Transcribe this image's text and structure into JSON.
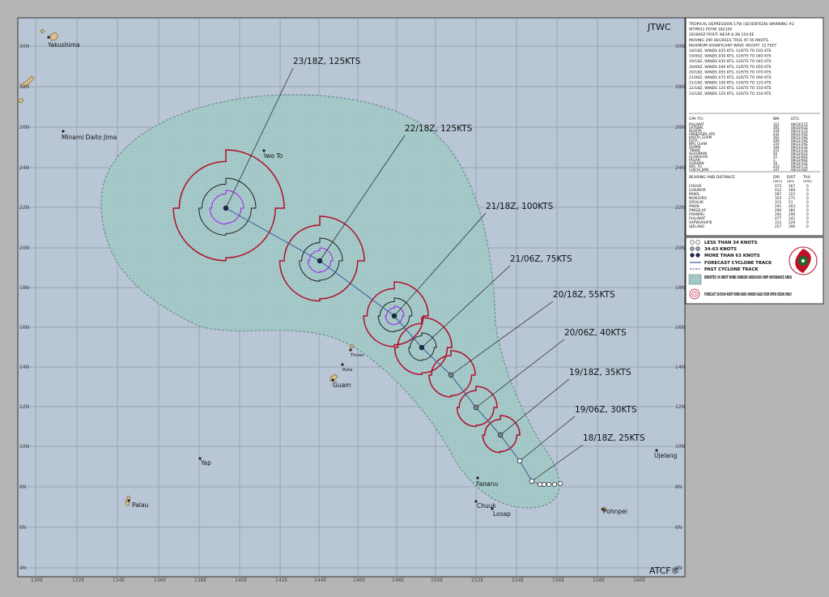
{
  "header": {
    "agency": "JTWC",
    "footer": "ATCF®"
  },
  "lat_labels": [
    "30N",
    "28N",
    "26N",
    "24N",
    "22N",
    "20N",
    "18N",
    "16N",
    "14N",
    "12N",
    "10N",
    "8N",
    "6N",
    "4N"
  ],
  "lon_labels": [
    "130E",
    "132E",
    "134E",
    "136E",
    "138E",
    "140E",
    "142E",
    "144E",
    "146E",
    "148E",
    "150E",
    "152E",
    "154E",
    "156E",
    "158E",
    "160E"
  ],
  "places": [
    {
      "name": "Yakushima"
    },
    {
      "name": "Minami Daito Jima"
    },
    {
      "name": "Iwo To"
    },
    {
      "name": "Tinian"
    },
    {
      "name": "Rota"
    },
    {
      "name": "Guam"
    },
    {
      "name": "Yap"
    },
    {
      "name": "Palau"
    },
    {
      "name": "Fananu"
    },
    {
      "name": "Chuuk"
    },
    {
      "name": "Losap"
    },
    {
      "name": "Pohnpei"
    },
    {
      "name": "Ujelang"
    }
  ],
  "forecast_points": [
    {
      "label": "18/18Z, 25KTS"
    },
    {
      "label": "19/06Z, 30KTS"
    },
    {
      "label": "19/18Z, 35KTS"
    },
    {
      "label": "20/06Z, 40KTS"
    },
    {
      "label": "20/18Z, 55KTS"
    },
    {
      "label": "21/06Z, 75KTS"
    },
    {
      "label": "21/18Z, 100KTS"
    },
    {
      "label": "22/18Z, 125KTS"
    },
    {
      "label": "23/18Z, 125KTS"
    }
  ],
  "warning_lines": [
    "TROPICAL DEPRESSION 17W (SEVENTEEN) WARNING #2",
    "WTPN31 PGTW 182100",
    "181800Z POSIT: NEAR 8.3N 154.6E",
    "MOVING 290 DEGREES TRUE AT 05 KNOTS",
    "MAXIMUM SIGNIFICANT WAVE HEIGHT: 12 FEET",
    "18/18Z, WINDS 025 KTS, GUSTS TO 035 KTS",
    "19/06Z, WINDS 030 KTS, GUSTS TO 040 KTS",
    "19/18Z, WINDS 035 KTS, GUSTS TO 045 KTS",
    "20/06Z, WINDS 040 KTS, GUSTS TO 050 KTS",
    "20/18Z, WINDS 055 KTS, GUSTS TO 070 KTS",
    "21/06Z, WINDS 075 KTS, GUSTS TO 090 KTS",
    "21/18Z, WINDS 100 KTS, GUSTS TO 125 KTS",
    "22/18Z, WINDS 125 KTS, GUSTS TO 150 KTS",
    "23/18Z, WINDS 125 KTS, GUSTS TO 150 KTS"
  ],
  "cpa_header": [
    "CPA TO:",
    "NM",
    "DTG"
  ],
  "cpa_rows": [
    [
      "PULUWAT",
      "321",
      "08/19/17Z"
    ],
    [
      "SATAWAL",
      "395",
      "08/20/03Z"
    ],
    [
      "NGATPA",
      "259",
      "08/21/17Z"
    ],
    [
      "ANDERSEN_AFB",
      "242",
      "08/21/19Z"
    ],
    [
      "KAVITA_GUAM",
      "262",
      "08/21/19Z"
    ],
    [
      "ROTA",
      "208",
      "08/21/19Z"
    ],
    [
      "NPS_GUAM",
      "250",
      "08/21/19Z"
    ],
    [
      "SAIPAN",
      "344",
      "08/21/23Z"
    ],
    [
      "TINIAN",
      "352",
      "08/21/23Z"
    ],
    [
      "AGATAMAN",
      "94",
      "08/22/02Z"
    ],
    [
      "ALAMAGAN",
      "25",
      "08/22/06Z"
    ],
    [
      "PAGAN",
      "3",
      "08/22/08Z"
    ],
    [
      "AGRIHAN",
      "29",
      "08/22/10Z"
    ],
    [
      "IWO_TO",
      "203",
      "08/23/17Z"
    ],
    [
      "CHICHI_JIMA",
      "347",
      "08/23/18Z"
    ]
  ],
  "bearing_header": [
    "BEARING AND DISTANCE",
    "DIR",
    "DIST",
    "TAU"
  ],
  "bearing_sub": [
    "(DEG)",
    "(NM)",
    "(HRS)"
  ],
  "bearing_rows": [
    [
      "CHUUK",
      "073",
      "167",
      "0"
    ],
    [
      "LUKUNOR",
      "012",
      "166",
      "0"
    ],
    [
      "MOKIL",
      "287",
      "322",
      "0"
    ],
    [
      "NUKUORO",
      "355",
      "271",
      "0"
    ],
    [
      "OROLUK",
      "315",
      "51",
      "0"
    ],
    [
      "PAKIN",
      "291",
      "203",
      "0"
    ],
    [
      "PINGELAP",
      "290",
      "384",
      "0"
    ],
    [
      "POHNPEI",
      "292",
      "290",
      "0"
    ],
    [
      "PULUWAT",
      "077",
      "341",
      "0"
    ],
    [
      "SAPWUAHFIK",
      "313",
      "229",
      "0"
    ],
    [
      "UJELANG",
      "257",
      "390",
      "0"
    ]
  ],
  "legend": [
    {
      "icon": "less-than-34-icon",
      "label": "LESS THAN 34 KNOTS"
    },
    {
      "icon": "34-63-icon",
      "label": "34-63 KNOTS"
    },
    {
      "icon": "more-than-63-icon",
      "label": "MORE THAN 63 KNOTS"
    },
    {
      "icon": "forecast-track-icon",
      "label": "FORECAST CYCLONE TRACK"
    },
    {
      "icon": "past-track-icon",
      "label": "PAST CYCLONE TRACK"
    },
    {
      "icon": "danger-area-icon",
      "label": "DENOTES 34 KNOT WIND DANGER AREA/USN SHIP AVOIDANCE AREA"
    },
    {
      "icon": "wind-radii-icon",
      "label": "FORECAST 34/50/64 KNOT WIND RADII (WINDS VALID OVER OPEN OCEAN ONLY)"
    }
  ],
  "colors": {
    "ocean": "#b9c6d6",
    "grid": "#8c98a8",
    "danger_fill": "#9ec4c4",
    "danger_edge": "#6f8f8f",
    "radii_34": "#b0102a",
    "radii_50": "#202020",
    "radii_64": "#a020f0",
    "track": "#3a5a9a",
    "land": "#d8c090"
  }
}
